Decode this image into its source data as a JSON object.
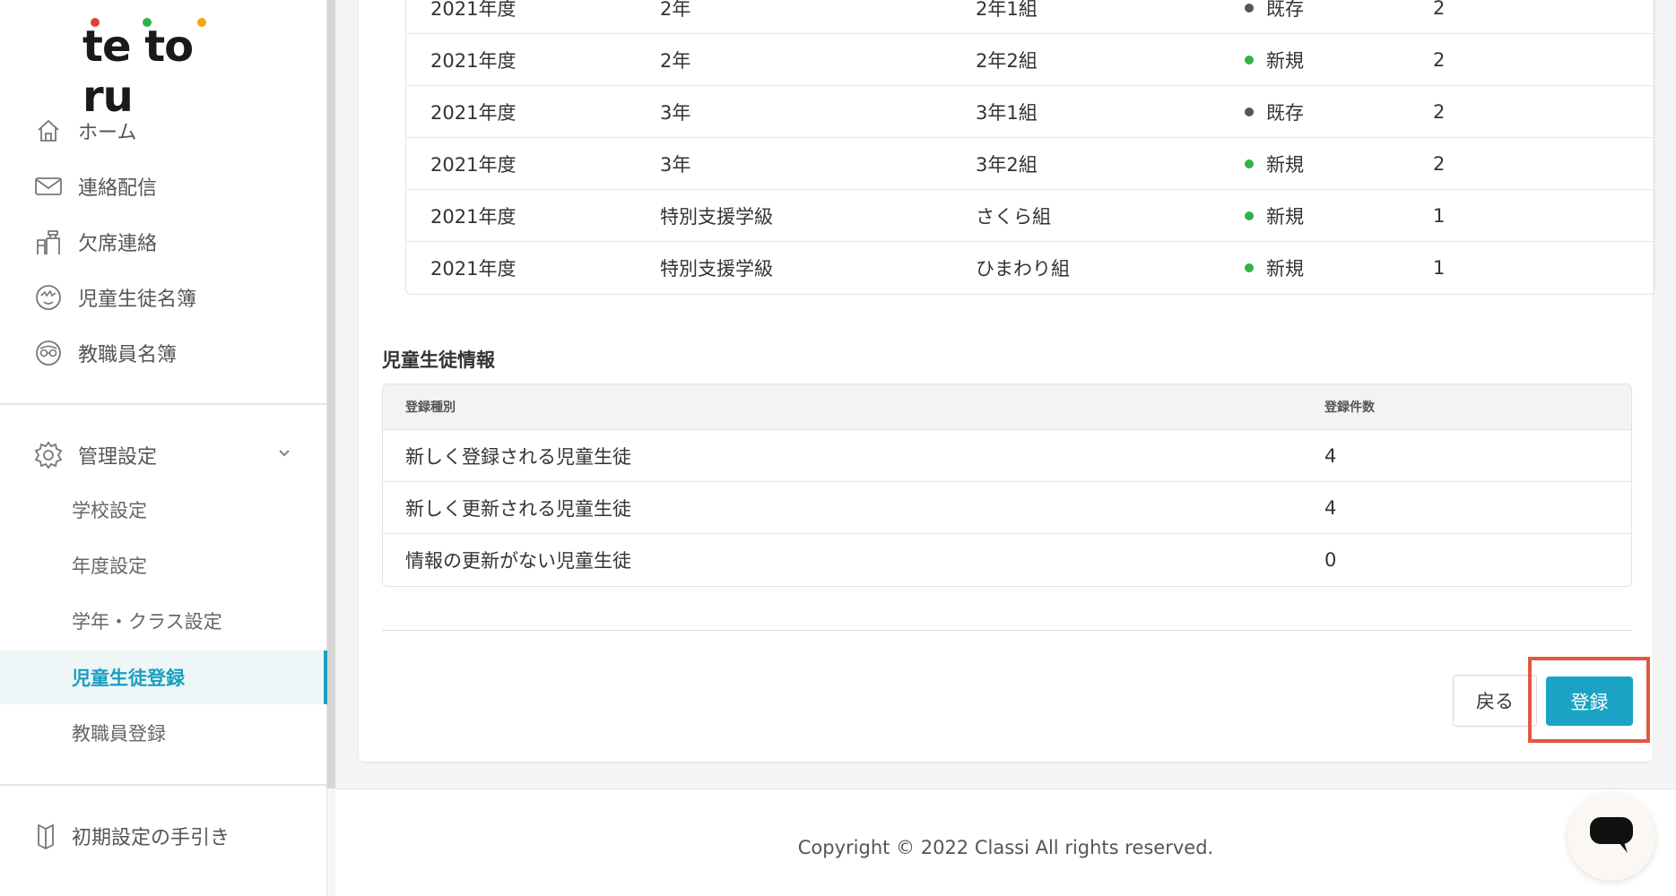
{
  "app": {
    "logo_text": "te to ru",
    "logo_dot_colors": [
      "#e2402f",
      "#2fb24a",
      "#f2a516"
    ]
  },
  "sidebar": {
    "items": [
      {
        "label": "ホーム",
        "icon": "home-icon"
      },
      {
        "label": "連絡配信",
        "icon": "mail-icon"
      },
      {
        "label": "欠席連絡",
        "icon": "desk-chair-icon"
      },
      {
        "label": "児童生徒名簿",
        "icon": "student-face-icon"
      },
      {
        "label": "教職員名簿",
        "icon": "teacher-face-icon"
      }
    ],
    "settings": {
      "label": "管理設定",
      "icon": "gear-icon",
      "sub_items": [
        {
          "label": "学校設定"
        },
        {
          "label": "年度設定"
        },
        {
          "label": "学年・クラス設定"
        },
        {
          "label": "児童生徒登録",
          "active": true
        },
        {
          "label": "教職員登録"
        }
      ]
    },
    "guide": {
      "label": "初期設定の手引き",
      "icon": "book-icon"
    }
  },
  "class_table": {
    "rows": [
      {
        "year": "2021年度",
        "grade": "2年",
        "class": "2年1組",
        "status": "既存",
        "status_color": "#555555",
        "count": "2"
      },
      {
        "year": "2021年度",
        "grade": "2年",
        "class": "2年2組",
        "status": "新規",
        "status_color": "#2fb24a",
        "count": "2"
      },
      {
        "year": "2021年度",
        "grade": "3年",
        "class": "3年1組",
        "status": "既存",
        "status_color": "#555555",
        "count": "2"
      },
      {
        "year": "2021年度",
        "grade": "3年",
        "class": "3年2組",
        "status": "新規",
        "status_color": "#2fb24a",
        "count": "2"
      },
      {
        "year": "2021年度",
        "grade": "特別支援学級",
        "class": "さくら組",
        "status": "新規",
        "status_color": "#2fb24a",
        "count": "1"
      },
      {
        "year": "2021年度",
        "grade": "特別支援学級",
        "class": "ひまわり組",
        "status": "新規",
        "status_color": "#2fb24a",
        "count": "1"
      }
    ]
  },
  "student_info": {
    "title": "児童生徒情報",
    "headers": [
      "登録種別",
      "登録件数"
    ],
    "rows": [
      {
        "type": "新しく登録される児童生徒",
        "count": "4"
      },
      {
        "type": "新しく更新される児童生徒",
        "count": "4"
      },
      {
        "type": "情報の更新がない児童生徒",
        "count": "0"
      }
    ]
  },
  "actions": {
    "back_label": "戻る",
    "register_label": "登録",
    "accent_color": "#1aa3c5"
  },
  "footer": {
    "copyright": "Copyright © 2022 Classi All rights reserved."
  },
  "chat": {
    "icon": "chat-bubble-icon"
  }
}
